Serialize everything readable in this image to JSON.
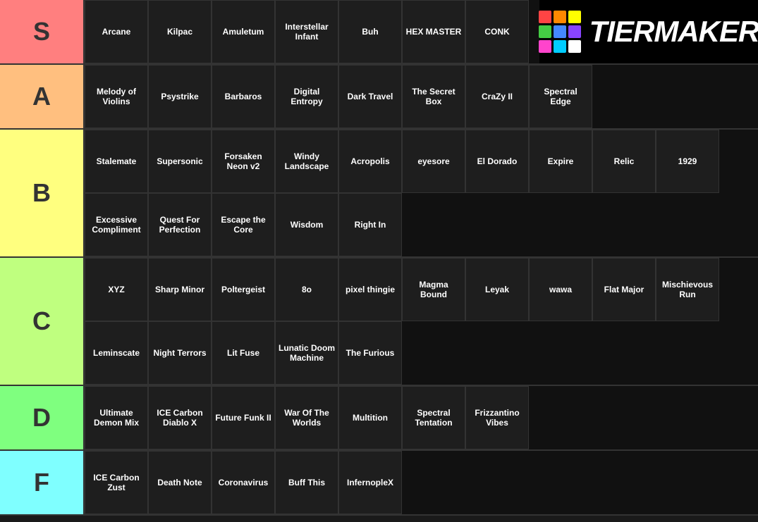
{
  "tiers": [
    {
      "id": "S",
      "label": "S",
      "color": "#ff7f7f",
      "items": [
        "Arcane",
        "Kilpac",
        "Amuletum",
        "Interstellar Infant",
        "Buh",
        "HEX MASTER",
        "CONK"
      ]
    },
    {
      "id": "A",
      "label": "A",
      "color": "#ffbf7f",
      "items": [
        "Melody of Violins",
        "Psystrike",
        "Barbaros",
        "Digital Entropy",
        "Dark Travel",
        "The Secret Box",
        "CraZy II",
        "Spectral Edge"
      ]
    },
    {
      "id": "B",
      "label": "B",
      "color": "#ffff7f",
      "items": [
        "Stalemate",
        "Supersonic",
        "Forsaken Neon v2",
        "Windy Landscape",
        "Acropolis",
        "eyesore",
        "El Dorado",
        "Expire",
        "Relic",
        "1929",
        "Excessive Compliment",
        "Quest For Perfection",
        "Escape the Core",
        "Wisdom",
        "Right In"
      ]
    },
    {
      "id": "C",
      "label": "C",
      "color": "#bfff7f",
      "items": [
        "XYZ",
        "Sharp Minor",
        "Poltergeist",
        "8o",
        "pixel thingie",
        "Magma Bound",
        "Leyak",
        "wawa",
        "Flat Major",
        "Mischievous Run",
        "Leminscate",
        "Night Terrors",
        "Lit Fuse",
        "Lunatic Doom Machine",
        "The Furious"
      ]
    },
    {
      "id": "D",
      "label": "D",
      "color": "#7fff7f",
      "items": [
        "Ultimate Demon Mix",
        "ICE Carbon Diablo X",
        "Future Funk II",
        "War Of The Worlds",
        "Multition",
        "Spectral Tentation",
        "Frizzantino Vibes"
      ]
    },
    {
      "id": "F",
      "label": "F",
      "color": "#7fffff",
      "items": [
        "ICE Carbon Zust",
        "Death Note",
        "Coronavirus",
        "Buff This",
        "InfernopleX"
      ]
    }
  ],
  "logo": {
    "colors": [
      "#ff4444",
      "#ff8800",
      "#ffff00",
      "#44ff44",
      "#4444ff",
      "#8800ff",
      "#ff44ff",
      "#00ffff",
      "#ffffff"
    ]
  }
}
